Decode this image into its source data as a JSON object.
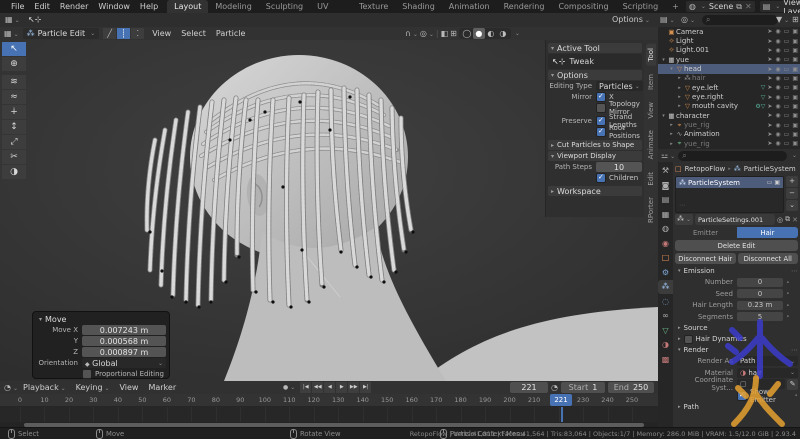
{
  "topbar": {
    "app_menus": [
      "File",
      "Edit",
      "Render",
      "Window",
      "Help"
    ],
    "workspace_tabs": [
      {
        "label": "Layout",
        "active": true
      },
      {
        "label": "Modeling"
      },
      {
        "label": "Sculpting"
      },
      {
        "label": "UV Editing"
      },
      {
        "label": "Texture Paint"
      },
      {
        "label": "Shading"
      },
      {
        "label": "Animation"
      },
      {
        "label": "Rendering"
      },
      {
        "label": "Compositing"
      },
      {
        "label": "Scripting"
      }
    ],
    "add_workspace": "+",
    "scene_selector": {
      "value": "Scene"
    },
    "view_layer_selector": {
      "value": "View Layer"
    }
  },
  "tool_settings": {
    "options_label": "Options"
  },
  "viewport_header": {
    "mode": "Particle Edit",
    "menus": [
      "View",
      "Select",
      "Particle"
    ],
    "select_modes": [
      {
        "name": "path-select-mode",
        "glyph": "╱"
      },
      {
        "name": "point-select-mode",
        "glyph": "┊",
        "active": true
      },
      {
        "name": "tip-select-mode",
        "glyph": "⁚"
      }
    ],
    "shading_modes": [
      {
        "name": "wireframe-shading",
        "glyph": "◯"
      },
      {
        "name": "solid-shading",
        "glyph": "●",
        "active": true
      },
      {
        "name": "material-shading",
        "glyph": "◐"
      },
      {
        "name": "rendered-shading",
        "glyph": "◑"
      }
    ]
  },
  "toolbar": {
    "tools": [
      {
        "name": "tweak-tool",
        "glyph": "↖",
        "active": true
      },
      {
        "name": "cursor-tool",
        "glyph": "⊕",
        "gap": true
      },
      {
        "name": "comb-tool",
        "glyph": "≋"
      },
      {
        "name": "smooth-tool",
        "glyph": "≈"
      },
      {
        "name": "add-tool",
        "glyph": "∔"
      },
      {
        "name": "length-tool",
        "glyph": "↕"
      },
      {
        "name": "puff-tool",
        "glyph": "⤢"
      },
      {
        "name": "cut-tool",
        "glyph": "✂"
      },
      {
        "name": "weight-tool",
        "glyph": "◑"
      }
    ]
  },
  "sidebar": {
    "tabs": [
      {
        "label": "Tool",
        "active": true
      },
      {
        "label": "Item"
      },
      {
        "label": "View"
      },
      {
        "label": "Animate"
      },
      {
        "label": "Edit"
      },
      {
        "label": "RPorter"
      }
    ],
    "active_tool": {
      "title": "Active Tool",
      "tool_name": "Tweak"
    },
    "options": {
      "title": "Options",
      "editing_type_label": "Editing Type",
      "editing_type": "Particles",
      "mirror_label": "Mirror",
      "mirror_x_label": "X",
      "topology_mirror_label": "Topology Mirror",
      "preserve_label": "Preserve",
      "strand_lengths_label": "Strand Lengths",
      "root_positions_label": "Root Positions",
      "cut_particles_label": "Cut Particles to Shape",
      "viewport_display_label": "Viewport Display",
      "path_steps_label": "Path Steps",
      "path_steps_value": "10",
      "children_label": "Children"
    },
    "workspace_title": "Workspace"
  },
  "move_panel": {
    "title": "Move",
    "fields": [
      {
        "label": "Move X",
        "value": "0.007243 m"
      },
      {
        "label": "Y",
        "value": "0.000568 m"
      },
      {
        "label": "Z",
        "value": "0.000897 m"
      }
    ],
    "orientation_label": "Orientation",
    "orientation_value": "Global",
    "proportional_label": "Proportional Editing"
  },
  "outliner": {
    "rows": [
      {
        "name": "Camera",
        "type": "camera",
        "indent": 0,
        "arrow": ""
      },
      {
        "name": "Light",
        "type": "light",
        "indent": 0,
        "arrow": ""
      },
      {
        "name": "Light.001",
        "type": "light",
        "indent": 0,
        "arrow": ""
      },
      {
        "name": "yue",
        "type": "collection",
        "indent": 0,
        "arrow": "▾"
      },
      {
        "name": "head",
        "type": "mesh",
        "indent": 1,
        "arrow": "▾",
        "selected": true
      },
      {
        "name": "hair",
        "type": "hair",
        "indent": 2,
        "arrow": "▸",
        "dim": true
      },
      {
        "name": "eye.left",
        "type": "mesh",
        "indent": 2,
        "arrow": "▸",
        "badges": "▽"
      },
      {
        "name": "eye.right",
        "type": "mesh",
        "indent": 2,
        "arrow": "▸",
        "badges": "▽"
      },
      {
        "name": "mouth cavity",
        "type": "mesh",
        "indent": 2,
        "arrow": "▸",
        "badges": "⚙▽"
      },
      {
        "name": "character",
        "type": "collection",
        "indent": 0,
        "arrow": "▾"
      },
      {
        "name": "yue_rig",
        "type": "armature",
        "indent": 1,
        "arrow": "▸",
        "dim": true
      },
      {
        "name": "Animation",
        "type": "action",
        "indent": 1,
        "arrow": "▸"
      },
      {
        "name": "yue_rig",
        "type": "armature-data",
        "indent": 1,
        "arrow": "▸",
        "dim": true
      }
    ]
  },
  "properties": {
    "breadcrumb": {
      "object": "RetopoFlow",
      "datablock": "ParticleSystem"
    },
    "particle_systems": {
      "items": [
        {
          "name": "ParticleSystem",
          "selected": true
        }
      ]
    },
    "settings_name": "ParticleSettings.001",
    "mode_toggle": {
      "emitter_label": "Emitter",
      "hair_label": "Hair"
    },
    "delete_edit_label": "Delete Edit",
    "disconnect_hair_label": "Disconnect Hair",
    "disconnect_all_label": "Disconnect All",
    "emission": {
      "title": "Emission",
      "fields": [
        {
          "label": "Number",
          "value": "0"
        },
        {
          "label": "Seed",
          "value": "0"
        },
        {
          "label": "Hair Length",
          "value": "0.23 m"
        },
        {
          "label": "Segments",
          "value": "5"
        }
      ]
    },
    "source_title": "Source",
    "hair_dynamics_title": "Hair Dynamics",
    "render": {
      "title": "Render",
      "render_as_label": "Render As",
      "render_as_value": "Path",
      "material_label": "Material",
      "material_value": "hair",
      "coordinate_label": "Coordinate Syst...",
      "show_emitter_label": "Show Emitter"
    },
    "path_title": "Path",
    "tabs": [
      {
        "name": "tab-tool",
        "glyph": "⚒",
        "color": "#b0b0b0"
      },
      {
        "name": "tab-render",
        "glyph": "◙",
        "color": "#b0b0b0"
      },
      {
        "name": "tab-output",
        "glyph": "▤",
        "color": "#b0b0b0"
      },
      {
        "name": "tab-view-layer",
        "glyph": "▦",
        "color": "#b0b0b0"
      },
      {
        "name": "tab-scene",
        "glyph": "◍",
        "color": "#b0b0b0"
      },
      {
        "name": "tab-world",
        "glyph": "◉",
        "color": "#c47878"
      },
      {
        "name": "tab-object",
        "glyph": "□",
        "color": "#e8935c"
      },
      {
        "name": "tab-modifiers",
        "glyph": "⚙",
        "color": "#7ea6d4"
      },
      {
        "name": "tab-particles",
        "glyph": "⁂",
        "color": "#9cc3ee",
        "active": true
      },
      {
        "name": "tab-physics",
        "glyph": "◌",
        "color": "#7ea6d4"
      },
      {
        "name": "tab-constraints",
        "glyph": "∞",
        "color": "#b0b0b0"
      },
      {
        "name": "tab-object-data",
        "glyph": "▽",
        "color": "#6fbf8f"
      },
      {
        "name": "tab-material",
        "glyph": "◑",
        "color": "#c47878"
      },
      {
        "name": "tab-texture",
        "glyph": "▩",
        "color": "#c47878"
      }
    ]
  },
  "timeline": {
    "menus": [
      {
        "label": "Playback",
        "caret": true
      },
      {
        "label": "Keying",
        "caret": true
      },
      {
        "label": "View"
      },
      {
        "label": "Marker"
      }
    ],
    "transport": [
      {
        "name": "jump-to-start",
        "glyph": "|◀"
      },
      {
        "name": "prev-keyframe",
        "glyph": "◀◀"
      },
      {
        "name": "play-reverse",
        "glyph": "◀"
      },
      {
        "name": "play",
        "glyph": "▶"
      },
      {
        "name": "next-keyframe",
        "glyph": "▶▶"
      },
      {
        "name": "jump-to-end",
        "glyph": "▶|"
      }
    ],
    "current_frame": "221",
    "start_label": "Start",
    "start_value": "1",
    "end_label": "End",
    "end_value": "250",
    "ticks": [
      "0",
      "10",
      "20",
      "30",
      "40",
      "50",
      "60",
      "70",
      "80",
      "90",
      "100",
      "110",
      "120",
      "130",
      "140",
      "150",
      "160",
      "170",
      "180",
      "190",
      "200",
      "210",
      "230",
      "240",
      "250"
    ],
    "playhead": "221"
  },
  "statusbar": {
    "hints": [
      {
        "label": "Select"
      },
      {
        "label": "Move"
      },
      {
        "label": "Rotate View"
      },
      {
        "label": "Particle Context Menu"
      }
    ],
    "stats": "RetopoFlow | Verts:41,811 | Faces:41,564 | Tris:83,064 | Objects:1/7 | Memory: 286.0 MiB | VRAM: 1.5/12.0 GiB | 2.93.4"
  },
  "watermark": {
    "ice_char": "冰",
    "fire_char": "火",
    "ice_color": "#3c3cd6",
    "fire_color": "#e6a030"
  },
  "colors": {
    "accent": "#4772b3",
    "header_bg": "#323232",
    "viewport_bg": "#3a3a3a"
  }
}
